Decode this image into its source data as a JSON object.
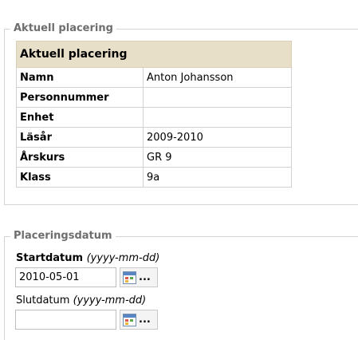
{
  "placement": {
    "legend": "Aktuell placering",
    "table_header": "Aktuell placering",
    "rows": [
      {
        "label": "Namn",
        "value": "Anton Johansson"
      },
      {
        "label": "Personnummer",
        "value": ""
      },
      {
        "label": "Enhet",
        "value": ""
      },
      {
        "label": "Läsår",
        "value": "2009-2010"
      },
      {
        "label": "Årskurs",
        "value": "GR 9"
      },
      {
        "label": "Klass",
        "value": "9a"
      }
    ]
  },
  "dates": {
    "legend": "Placeringsdatum",
    "start_label": "Startdatum",
    "start_hint": "(yyyy-mm-dd)",
    "start_value": "2010-05-01",
    "end_label": "Slutdatum",
    "end_hint": "(yyyy-mm-dd)",
    "end_value": "",
    "calendar_button_label": "..."
  }
}
